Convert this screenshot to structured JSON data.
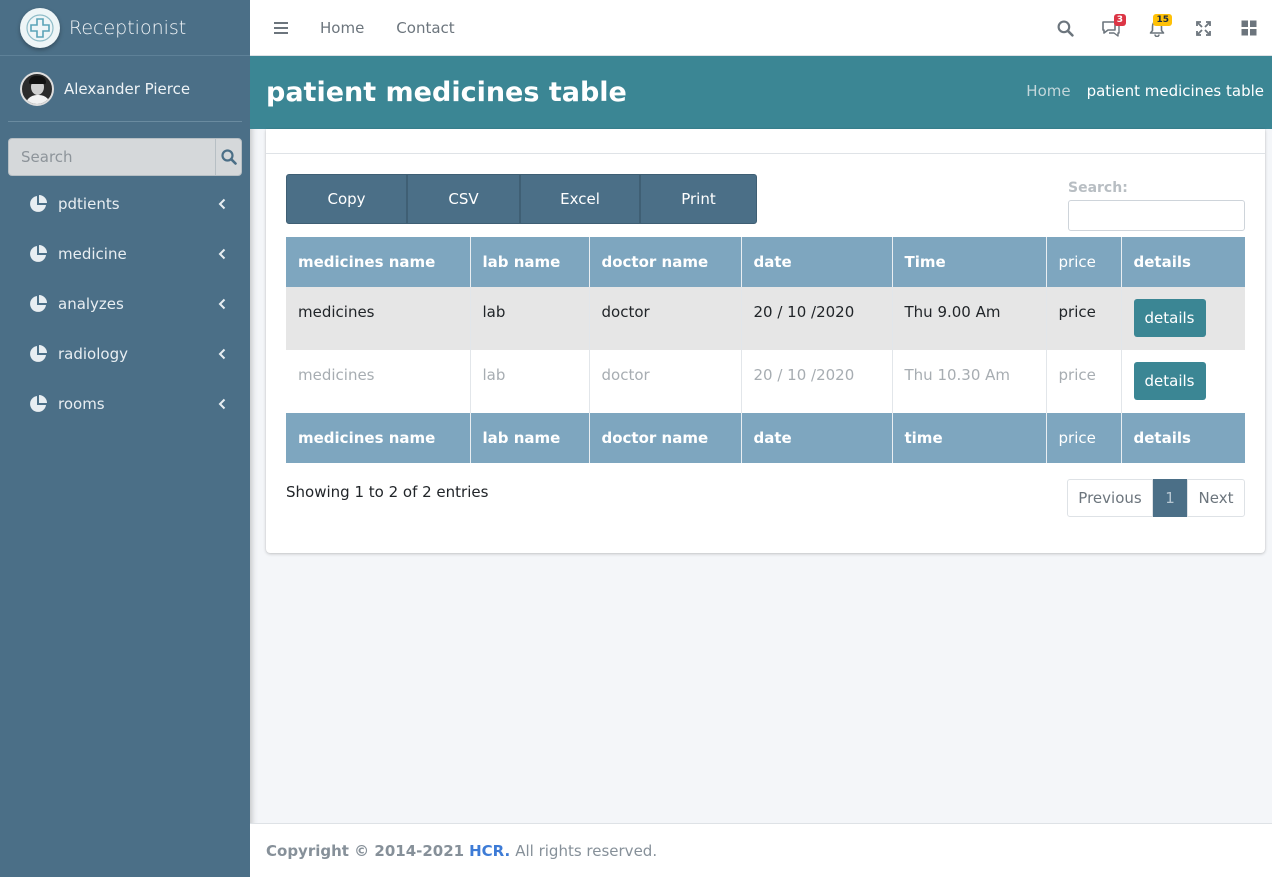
{
  "sidebar": {
    "brand": "Receptionist",
    "user": "Alexander Pierce",
    "search_placeholder": "Search",
    "items": [
      {
        "label": "pdtients"
      },
      {
        "label": "medicine"
      },
      {
        "label": "analyzes"
      },
      {
        "label": "radiology"
      },
      {
        "label": "rooms"
      }
    ]
  },
  "topbar": {
    "links": [
      "Home",
      "Contact"
    ],
    "messages_count": "3",
    "notifications_count": "15"
  },
  "header": {
    "title": "patient medicines table",
    "breadcrumb": [
      "Home",
      "patient medicines table"
    ]
  },
  "table_tools": {
    "buttons": [
      "Copy",
      "CSV",
      "Excel",
      "Print"
    ],
    "search_label": "Search:"
  },
  "table": {
    "columns": [
      "medicines name",
      "lab name",
      "doctor name",
      "date",
      "Time",
      "price",
      "details"
    ],
    "footer_columns": [
      "medicines name",
      "lab name",
      "doctor name",
      "date",
      "time",
      "price",
      "details"
    ],
    "rows": [
      [
        "medicines",
        "lab",
        "doctor",
        "20 / 10 /2020",
        "Thu 9.00 Am",
        "price",
        "details"
      ],
      [
        "medicines",
        "lab",
        "doctor",
        "20 / 10 /2020",
        "Thu 10.30 Am",
        "price",
        "details"
      ]
    ]
  },
  "pagination": {
    "info": "Showing 1 to 2 of 2 entries",
    "previous": "Previous",
    "current": "1",
    "next": "Next"
  },
  "footer": {
    "copyright": "Copyright © 2014-2021",
    "brand": "HCR.",
    "rights": "All rights reserved."
  },
  "colors": {
    "sidebar": "#4b6f87",
    "header": "#3b8694",
    "table_head": "#7ea6bf",
    "link": "#3d7bd6"
  }
}
